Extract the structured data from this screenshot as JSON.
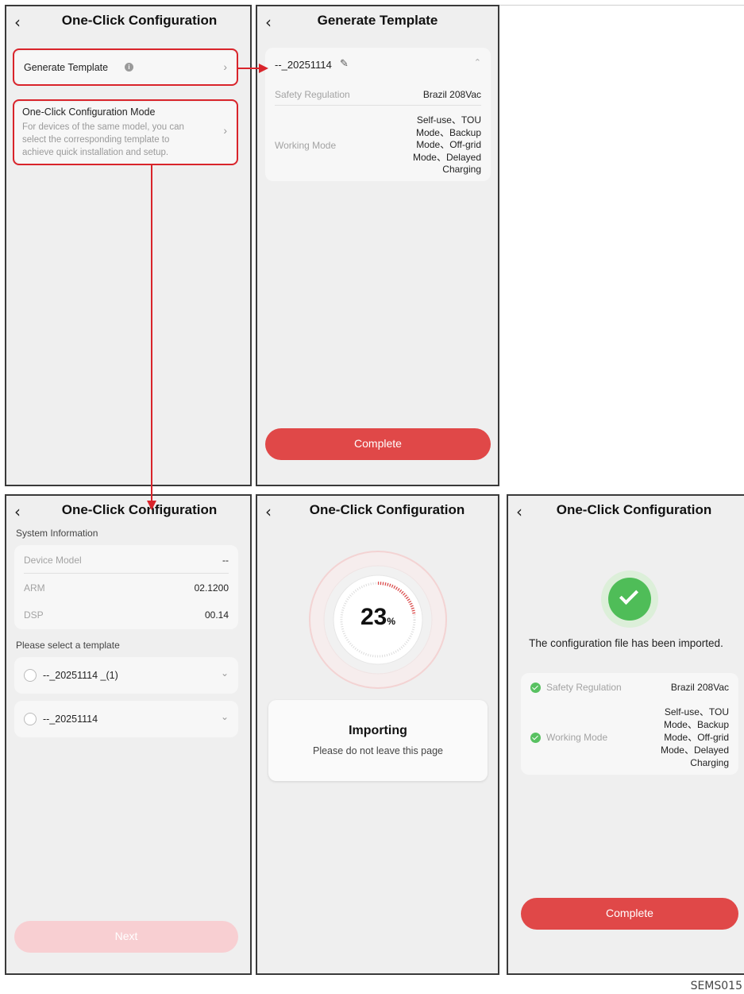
{
  "screen1": {
    "title": "One-Click Configuration",
    "generate_template_label": "Generate Template",
    "mode_title": "One-Click Configuration Mode",
    "mode_desc_1": "For devices of the same model, you can",
    "mode_desc_2": "select the corresponding template to",
    "mode_desc_3": "achieve quick installation and setup."
  },
  "screen2": {
    "title": "Generate Template",
    "template_name": "--_20251114",
    "safety_label": "Safety Regulation",
    "safety_value": "Brazil 208Vac",
    "working_label": "Working Mode",
    "working_lines": [
      "Self-use、TOU",
      "Mode、Backup",
      "Mode、Off-grid",
      "Mode、Delayed",
      "Charging"
    ],
    "complete_label": "Complete"
  },
  "screen3": {
    "title": "One-Click Configuration",
    "system_info_label": "System Information",
    "device_model_label": "Device Model",
    "device_model_value": "--",
    "arm_label": "ARM",
    "arm_value": "02.1200",
    "dsp_label": "DSP",
    "dsp_value": "00.14",
    "select_label": "Please select a template",
    "templates": [
      "--_20251114 _(1)",
      "--_20251114"
    ],
    "next_label": "Next"
  },
  "screen4": {
    "title": "One-Click Configuration",
    "progress_number": "23",
    "progress_unit": "%",
    "progress_value": 0.23,
    "importing_title": "Importing",
    "importing_desc": "Please do not leave this page"
  },
  "screen5": {
    "title": "One-Click Configuration",
    "success_message": "The configuration file has been imported.",
    "safety_label": "Safety Regulation",
    "safety_value": "Brazil 208Vac",
    "working_label": "Working Mode",
    "working_lines": [
      "Self-use、TOU",
      "Mode、Backup",
      "Mode、Off-grid",
      "Mode、Delayed",
      "Charging"
    ],
    "complete_label": "Complete"
  },
  "figure_code": "SEMS015",
  "colors": {
    "accent_red": "#e04848",
    "highlight_red": "#d9242b",
    "success_green": "#58c161",
    "disabled_pink": "#f8cfd2"
  },
  "icons": [
    "back-arrow-icon",
    "info-icon",
    "chevron-right-icon",
    "edit-pencil-icon",
    "chevron-up-icon",
    "chevron-down-icon",
    "radio-icon",
    "success-check-icon"
  ]
}
